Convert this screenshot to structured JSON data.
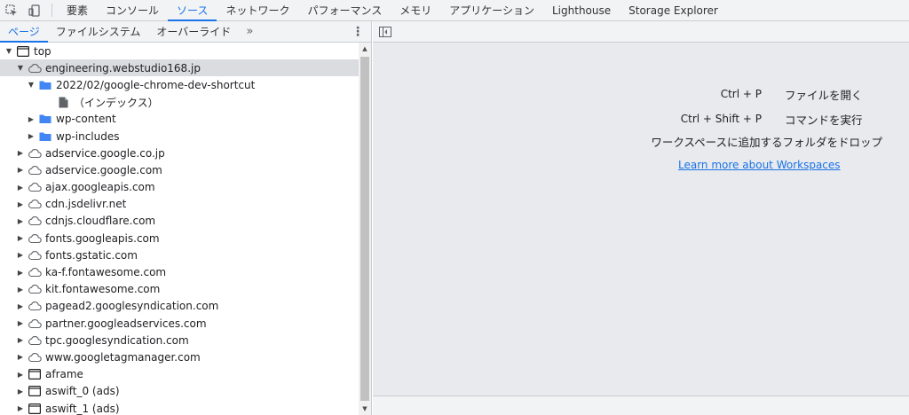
{
  "toolbar": {
    "tabs": [
      {
        "label": "要素",
        "active": false
      },
      {
        "label": "コンソール",
        "active": false
      },
      {
        "label": "ソース",
        "active": true
      },
      {
        "label": "ネットワーク",
        "active": false
      },
      {
        "label": "パフォーマンス",
        "active": false
      },
      {
        "label": "メモリ",
        "active": false
      },
      {
        "label": "アプリケーション",
        "active": false
      },
      {
        "label": "Lighthouse",
        "active": false
      },
      {
        "label": "Storage Explorer",
        "active": false
      }
    ],
    "icons": [
      "inspect-element-icon",
      "device-toolbar-icon"
    ]
  },
  "left_panel": {
    "subtabs": [
      {
        "label": "ページ",
        "active": true
      },
      {
        "label": "ファイルシステム",
        "active": false
      },
      {
        "label": "オーバーライド",
        "active": false
      }
    ],
    "overflow_glyph": "»",
    "menu_glyph": "⋮"
  },
  "tree": [
    {
      "label": "top",
      "indent": 0,
      "arrow": "down",
      "icon": "frame",
      "selected": false
    },
    {
      "label": "engineering.webstudio168.jp",
      "indent": 1,
      "arrow": "down",
      "icon": "cloud",
      "selected": true
    },
    {
      "label": "2022/02/google-chrome-dev-shortcut",
      "indent": 2,
      "arrow": "down",
      "icon": "folder",
      "selected": false
    },
    {
      "label": "（インデックス）",
      "indent": 3,
      "arrow": "none",
      "icon": "file",
      "selected": false
    },
    {
      "label": "wp-content",
      "indent": 2,
      "arrow": "right",
      "icon": "folder",
      "selected": false
    },
    {
      "label": "wp-includes",
      "indent": 2,
      "arrow": "right",
      "icon": "folder",
      "selected": false
    },
    {
      "label": "adservice.google.co.jp",
      "indent": 1,
      "arrow": "right",
      "icon": "cloud",
      "selected": false
    },
    {
      "label": "adservice.google.com",
      "indent": 1,
      "arrow": "right",
      "icon": "cloud",
      "selected": false
    },
    {
      "label": "ajax.googleapis.com",
      "indent": 1,
      "arrow": "right",
      "icon": "cloud",
      "selected": false
    },
    {
      "label": "cdn.jsdelivr.net",
      "indent": 1,
      "arrow": "right",
      "icon": "cloud",
      "selected": false
    },
    {
      "label": "cdnjs.cloudflare.com",
      "indent": 1,
      "arrow": "right",
      "icon": "cloud",
      "selected": false
    },
    {
      "label": "fonts.googleapis.com",
      "indent": 1,
      "arrow": "right",
      "icon": "cloud",
      "selected": false
    },
    {
      "label": "fonts.gstatic.com",
      "indent": 1,
      "arrow": "right",
      "icon": "cloud",
      "selected": false
    },
    {
      "label": "ka-f.fontawesome.com",
      "indent": 1,
      "arrow": "right",
      "icon": "cloud",
      "selected": false
    },
    {
      "label": "kit.fontawesome.com",
      "indent": 1,
      "arrow": "right",
      "icon": "cloud",
      "selected": false
    },
    {
      "label": "pagead2.googlesyndication.com",
      "indent": 1,
      "arrow": "right",
      "icon": "cloud",
      "selected": false
    },
    {
      "label": "partner.googleadservices.com",
      "indent": 1,
      "arrow": "right",
      "icon": "cloud",
      "selected": false
    },
    {
      "label": "tpc.googlesyndication.com",
      "indent": 1,
      "arrow": "right",
      "icon": "cloud",
      "selected": false
    },
    {
      "label": "www.googletagmanager.com",
      "indent": 1,
      "arrow": "right",
      "icon": "cloud",
      "selected": false
    },
    {
      "label": "aframe",
      "indent": 1,
      "arrow": "right",
      "icon": "frame",
      "selected": false
    },
    {
      "label": "aswift_0 (ads)",
      "indent": 1,
      "arrow": "right",
      "icon": "frame",
      "selected": false
    },
    {
      "label": "aswift_1 (ads)",
      "indent": 1,
      "arrow": "right",
      "icon": "frame",
      "selected": false
    }
  ],
  "right_panel": {
    "shortcuts": [
      {
        "keys": "Ctrl + P",
        "action": "ファイルを開く"
      },
      {
        "keys": "Ctrl + Shift + P",
        "action": "コマンドを実行"
      }
    ],
    "drop_message": "ワークスペースに追加するフォルダをドロップ",
    "learn_more": "Learn more about Workspaces"
  },
  "colors": {
    "accent": "#1a73e8",
    "folder": "#4285f4",
    "panel_bg": "#e8eaed"
  }
}
